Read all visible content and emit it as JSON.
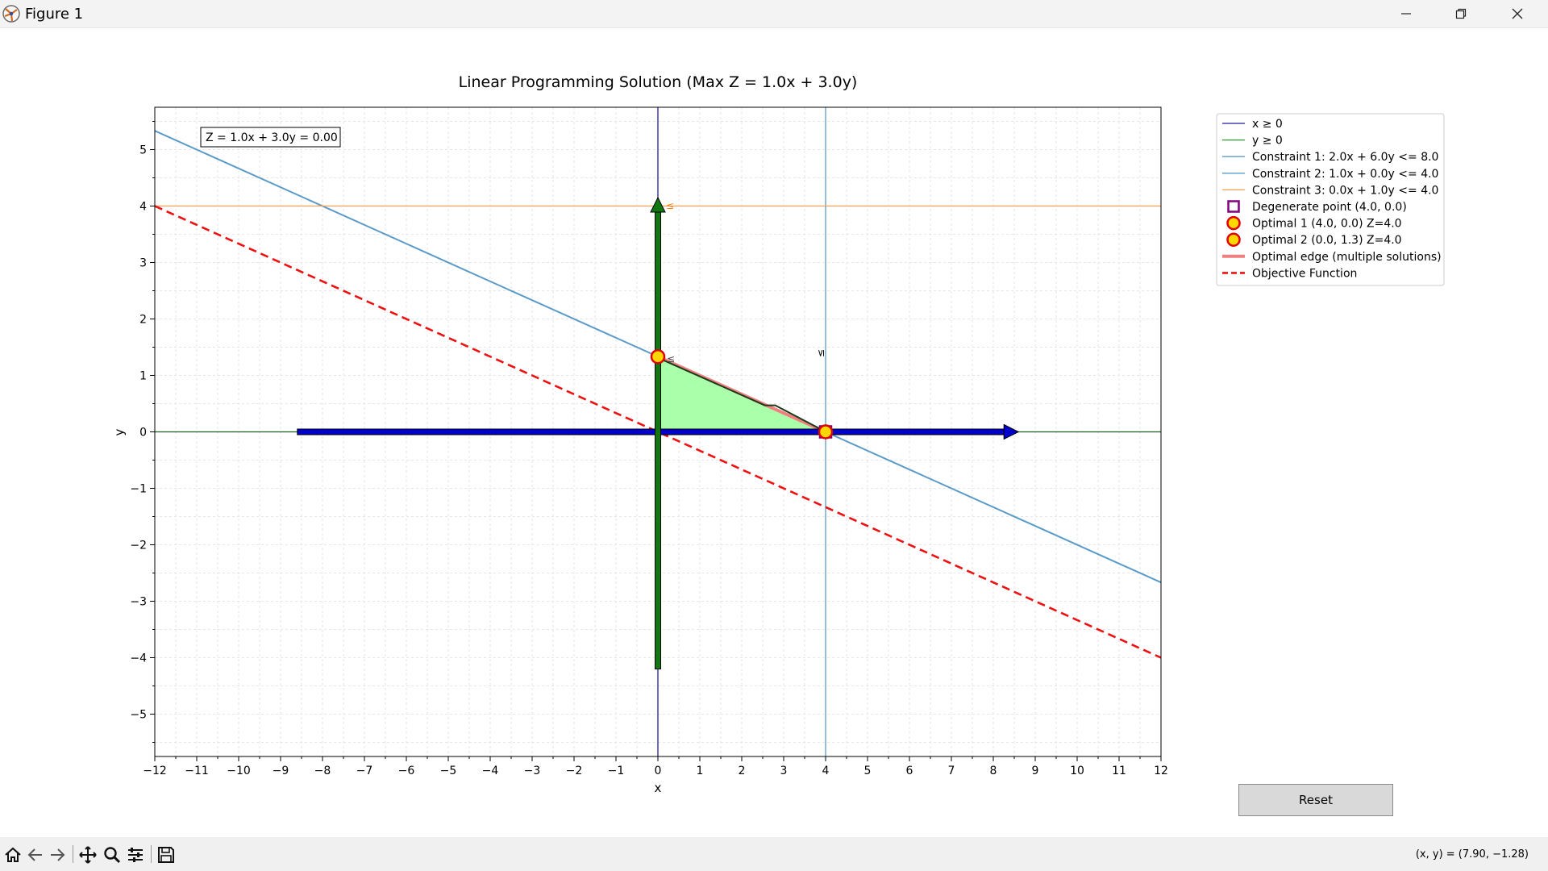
{
  "window": {
    "title": "Figure 1",
    "controls": [
      "minimize",
      "restore",
      "close"
    ]
  },
  "chart_data": {
    "type": "line",
    "title": "Linear Programming Solution (Max Z = 1.0x + 3.0y)",
    "xlabel": "x",
    "ylabel": "y",
    "xlim": [
      -12,
      12
    ],
    "ylim": [
      -5.75,
      5.75
    ],
    "xticks": [
      -12,
      -11,
      -10,
      -9,
      -8,
      -7,
      -6,
      -5,
      -4,
      -3,
      -2,
      -1,
      0,
      1,
      2,
      3,
      4,
      5,
      6,
      7,
      8,
      9,
      10,
      11,
      12
    ],
    "yticks": [
      -5,
      -4,
      -3,
      -2,
      -1,
      0,
      1,
      2,
      3,
      4,
      5
    ],
    "grid": true,
    "legend_position": "outside-right-top",
    "objective_annotation": "Z = 1.0x + 3.0y = 0.00",
    "constraint_markers": [
      "≤",
      "≤",
      "≤"
    ],
    "series": [
      {
        "name": "x ≥ 0",
        "kind": "vline",
        "x": 0,
        "color": "#1f1f9f"
      },
      {
        "name": "y ≥ 0",
        "kind": "hline",
        "y": 0,
        "color": "#2ca02c"
      },
      {
        "name": "Constraint 1: 2.0x + 6.0y <= 8.0",
        "kind": "line",
        "x": [
          -12,
          12
        ],
        "y": [
          5.333,
          -2.667
        ],
        "color": "#5b9bc8"
      },
      {
        "name": "Constraint 2: 1.0x + 0.0y <= 4.0",
        "kind": "vline",
        "x": 4,
        "color": "#5b9bc8"
      },
      {
        "name": "Constraint 3: 0.0x + 1.0y <= 4.0",
        "kind": "hline",
        "y": 4,
        "color": "#ff9f4f"
      },
      {
        "name": "Degenerate point (4.0, 0.0)",
        "kind": "marker-square",
        "x": 4.0,
        "y": 0.0,
        "color": "#800080"
      },
      {
        "name": "Optimal 1 (4.0, 0.0) Z=4.0",
        "kind": "marker-circle",
        "x": 4.0,
        "y": 0.0,
        "color": "#ffd700",
        "edge": "#e00000"
      },
      {
        "name": "Optimal 2 (0.0, 1.3) Z=4.0",
        "kind": "marker-circle",
        "x": 0.0,
        "y": 1.333,
        "color": "#ffd700",
        "edge": "#e00000"
      },
      {
        "name": "Optimal edge (multiple solutions)",
        "kind": "segment",
        "x": [
          0,
          4
        ],
        "y": [
          1.333,
          0
        ],
        "color": "#f08080"
      },
      {
        "name": "Objective Function",
        "kind": "dashed-line",
        "x": [
          -12,
          12
        ],
        "y": [
          4,
          -4
        ],
        "color": "#ee1111"
      }
    ],
    "feasible_region": {
      "x": [
        0,
        4,
        0
      ],
      "y": [
        0,
        0,
        1.333
      ],
      "color": "#aaffaa"
    },
    "arrows": [
      {
        "from": [
          -8.6,
          0
        ],
        "to": [
          8.6,
          0
        ],
        "color": "#0000cc"
      },
      {
        "from": [
          0,
          -4.2
        ],
        "to": [
          0,
          4.15
        ],
        "color": "#117711"
      }
    ]
  },
  "reset_button": {
    "label": "Reset"
  },
  "toolbar": {
    "icons": [
      "home-icon",
      "back-icon",
      "forward-icon",
      "pan-icon",
      "zoom-icon",
      "configure-icon",
      "save-icon"
    ],
    "coords": "(x, y) = (7.90, −1.28)"
  }
}
